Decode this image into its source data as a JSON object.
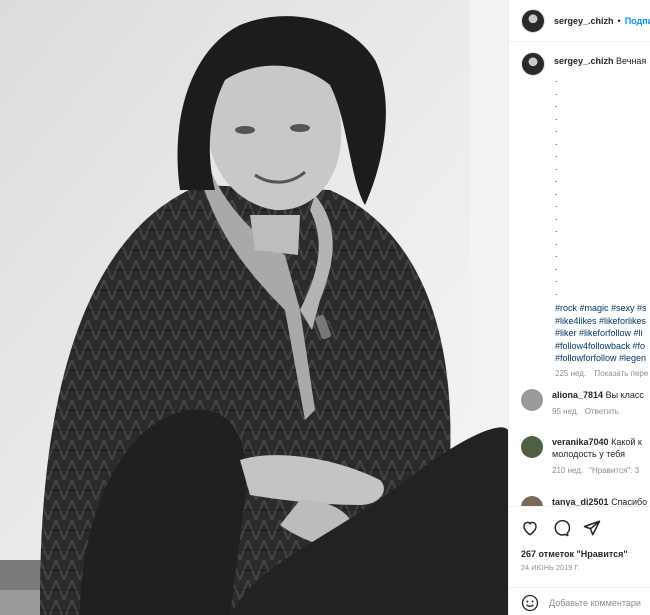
{
  "post": {
    "username": "sergey_.chizh",
    "dot": "•",
    "follow_label": "Подпи"
  },
  "caption": {
    "username": "sergey_.chizh",
    "text": "Вечная",
    "dots": [
      ".",
      ".",
      ".",
      ".",
      ".",
      ".",
      ".",
      ".",
      ".",
      ".",
      ".",
      ".",
      ".",
      ".",
      ".",
      ".",
      ".",
      "."
    ],
    "hashtags": [
      "#rock #magic #sexy #s",
      "#like4likes #likeforlikes",
      "#liker #likeforfollow #li",
      "#follow4followback #fo",
      "#followforfollow #legen"
    ],
    "time": "225 нед.",
    "translate": "Показать пере"
  },
  "comments": [
    {
      "username": "aliona_7814",
      "text": "Вы класс",
      "text2": "",
      "time": "95 нед.",
      "action": "Ответить",
      "avatar_color": "#9a9a9a"
    },
    {
      "username": "veranika7040",
      "text": "Какой к",
      "text2": "молодость у тебя",
      "time": "210 нед.",
      "action": "\"Нравится\": 3",
      "avatar_color": "#4f5f46"
    },
    {
      "username": "tanya_di2501",
      "text": "Спасибо",
      "text2": "",
      "time": "",
      "action": "",
      "avatar_color": "#7a6a5a"
    }
  ],
  "actions": {
    "likes": "267 отметок \"Нравится\"",
    "date": "24 ИЮНЬ 2019 Г.",
    "comment_placeholder": "Добавьте комментари"
  },
  "icons": [
    "heart-icon",
    "comment-icon",
    "share-icon",
    "emoji-icon"
  ]
}
